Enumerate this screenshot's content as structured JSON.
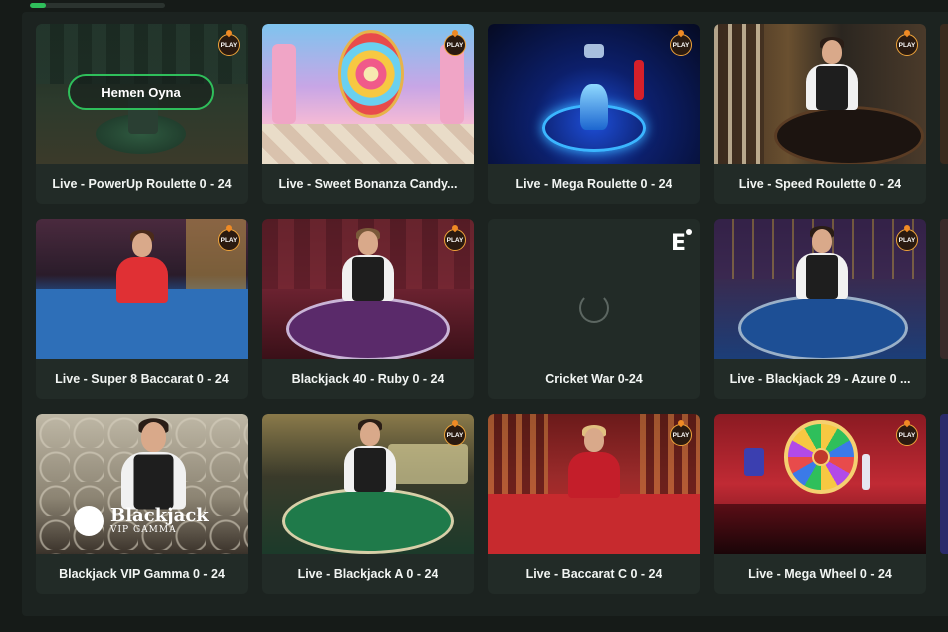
{
  "progress": {
    "fraction": 0.12
  },
  "hover_button_label": "Hemen Oyna",
  "badge_label": "PLAY",
  "loading_logo": "E",
  "vip_logo": {
    "title": "Blackjack",
    "subtitle": "VIP GAMMA"
  },
  "games": [
    {
      "title": "Live - PowerUp Roulette 0 - 24"
    },
    {
      "title": "Live - Sweet Bonanza Candy..."
    },
    {
      "title": "Live - Mega Roulette 0 - 24"
    },
    {
      "title": "Live - Speed Roulette 0 - 24"
    },
    {
      "title": "Live - Super 8 Baccarat 0 - 24"
    },
    {
      "title": "Blackjack 40 - Ruby 0 - 24"
    },
    {
      "title": "Cricket War 0-24"
    },
    {
      "title": "Live - Blackjack 29 - Azure 0 ..."
    },
    {
      "title": "Blackjack VIP Gamma 0 - 24"
    },
    {
      "title": "Live - Blackjack A 0 - 24"
    },
    {
      "title": "Live - Baccarat C 0 - 24"
    },
    {
      "title": "Live - Mega Wheel 0 - 24"
    }
  ],
  "colors": {
    "accent": "#2fbf5b",
    "card_bg": "#222b27",
    "page_bg": "#161b18"
  }
}
